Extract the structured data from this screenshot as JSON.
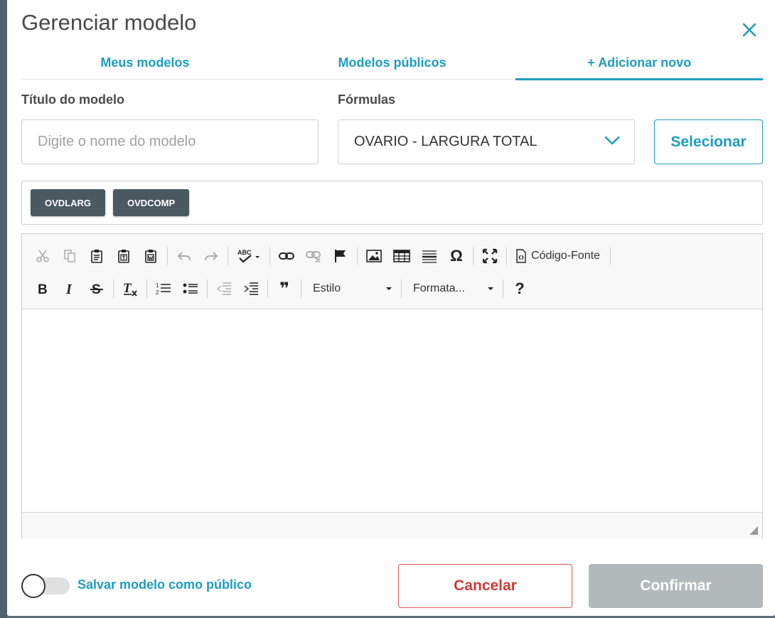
{
  "modal": {
    "title": "Gerenciar modelo"
  },
  "tabs": [
    {
      "label": "Meus modelos",
      "active": false
    },
    {
      "label": "Modelos públicos",
      "active": false
    },
    {
      "label": "+ Adicionar novo",
      "active": true
    }
  ],
  "form": {
    "title_label": "Título do modelo",
    "title_placeholder": "Digite o nome do modelo",
    "title_value": "",
    "formulas_label": "Fórmulas",
    "formula_selected": "OVARIO - LARGURA TOTAL",
    "select_button": "Selecionar"
  },
  "tags": [
    "OVDLARG",
    "OVDCOMP"
  ],
  "editor": {
    "source_label": "Código-Fonte",
    "style_combo": "Estilo",
    "format_combo": "Formata...",
    "help_glyph": "?",
    "omega_glyph": "Ω",
    "quote_glyph": "❞",
    "content": ""
  },
  "footer": {
    "public_label": "Salvar modelo como público",
    "public_toggle_on": false,
    "cancel_label": "Cancelar",
    "confirm_label": "Confirmar"
  },
  "colors": {
    "accent": "#1e9dbf",
    "tag_bg": "#4b5a61",
    "danger": "#d9534f",
    "disabled": "#b3b8bb"
  }
}
